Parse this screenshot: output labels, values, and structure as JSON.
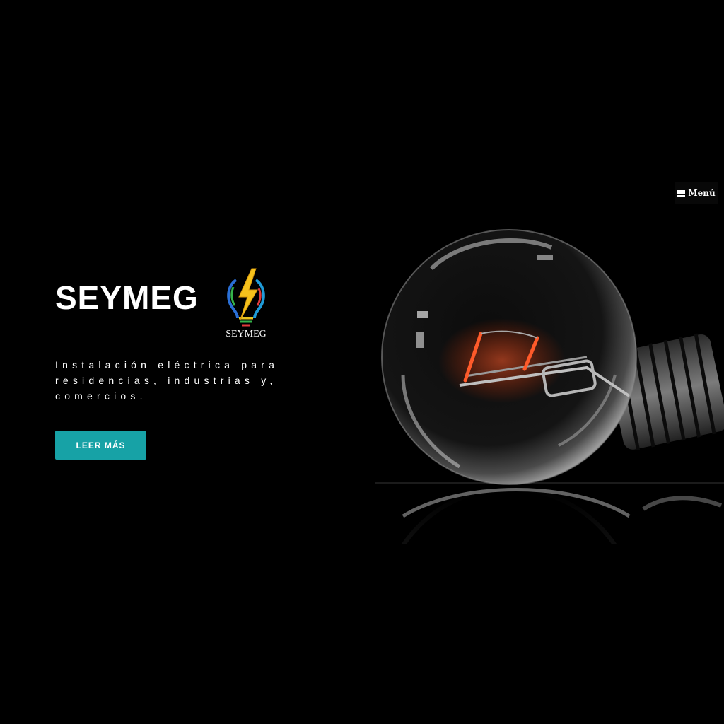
{
  "nav": {
    "menu_label": "Menú",
    "menu_icon": "hamburger-icon"
  },
  "hero": {
    "title": "SEYMEG",
    "logo_text": "SEYMEG",
    "tagline": "Instalación eléctrica para residencias, industrias y, comercios.",
    "cta_label": "LEER MÁS"
  },
  "colors": {
    "background": "#000000",
    "accent": "#17a2a6",
    "text": "#ffffff"
  }
}
